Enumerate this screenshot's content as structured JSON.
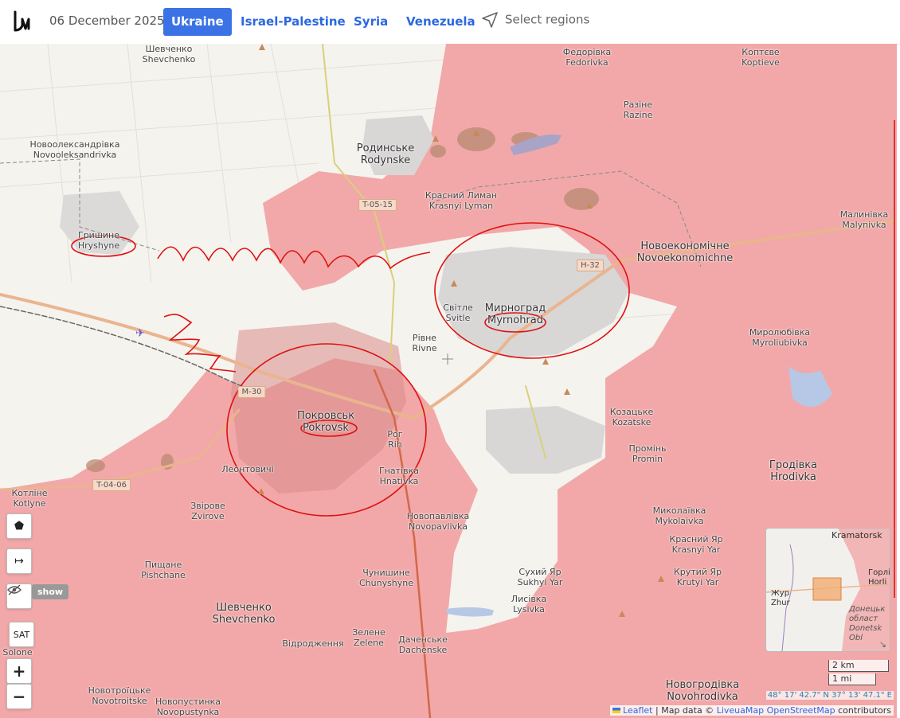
{
  "header": {
    "date": "06 December 2025",
    "tabs": [
      {
        "label": "Ukraine",
        "active": true
      },
      {
        "label": "Israel-Palestine",
        "active": false
      },
      {
        "label": "Syria",
        "active": false
      },
      {
        "label": "Venezuela",
        "active": false
      }
    ],
    "select_regions": "Select regions"
  },
  "map": {
    "labels": [
      {
        "uk": "Шевченко",
        "en": "Shevchenko"
      },
      {
        "uk": "Федорівка",
        "en": "Fedorivka"
      },
      {
        "uk": "Коптєве",
        "en": "Koptieve"
      },
      {
        "uk": "Разіне",
        "en": "Razine"
      },
      {
        "uk": "Новоолександрівка",
        "en": "Novooleksandrivka"
      },
      {
        "uk": "Родинське",
        "en": "Rodynske"
      },
      {
        "uk": "Красний Лиман",
        "en": "Krasnyi Lyman"
      },
      {
        "uk": "Гришине",
        "en": "Hryshyne"
      },
      {
        "uk": "Малинівка",
        "en": "Malynivka"
      },
      {
        "uk": "Новоекономічне",
        "en": "Novoekonomichne"
      },
      {
        "uk": "Мирноград",
        "en": "Myrnohrad"
      },
      {
        "uk": "Світле",
        "en": "Svitle"
      },
      {
        "uk": "Рівне",
        "en": "Rivne"
      },
      {
        "uk": "Миролюбівка",
        "en": "Myroliubivka"
      },
      {
        "uk": "Покровськ",
        "en": "Pokrovsk"
      },
      {
        "uk": "Рог",
        "en": "Rih"
      },
      {
        "uk": "Козацьке",
        "en": "Kozatske"
      },
      {
        "uk": "Промінь",
        "en": "Promin"
      },
      {
        "uk": "Леонтовичі",
        "en": ""
      },
      {
        "uk": "Гнатівка",
        "en": "Hnativka"
      },
      {
        "uk": "Котліне",
        "en": "Kotlyne"
      },
      {
        "uk": "Звірове",
        "en": "Zvirove"
      },
      {
        "uk": "Новопавлівка",
        "en": "Novopavlivka"
      },
      {
        "uk": "Гродівка",
        "en": "Hrodivka"
      },
      {
        "uk": "Миколаївка",
        "en": "Mykolaivka"
      },
      {
        "uk": "Красний Яр",
        "en": "Krasnyi Yar"
      },
      {
        "uk": "Пищане",
        "en": "Pishchane"
      },
      {
        "uk": "Сухий Яр",
        "en": "Sukhyi Yar"
      },
      {
        "uk": "Крутий Яр",
        "en": "Krutyi Yar"
      },
      {
        "uk": "Чунишине",
        "en": "Chunyshyne"
      },
      {
        "uk": "Лисівка",
        "en": "Lysivka"
      },
      {
        "uk": "Шевченко",
        "en": "Shevchenko"
      },
      {
        "uk": "Зелене",
        "en": "Zelene"
      },
      {
        "uk": "Відродження",
        "en": ""
      },
      {
        "uk": "Даченське",
        "en": "Dachenske"
      },
      {
        "uk": "Новогродівка",
        "en": "Novohrodivka"
      },
      {
        "uk": "Новотроїцьке",
        "en": "Novotroitske"
      },
      {
        "uk": "Новопустинка",
        "en": "Novopustynka"
      },
      {
        "uk": "",
        "en": "Solone"
      }
    ],
    "road_shields": [
      "T-05-15",
      "H-32",
      "M-30",
      "T-04-06"
    ],
    "controls": {
      "polygon": "⬟",
      "measure": "↦",
      "hide": "show",
      "sat": "SAT",
      "zoom_in": "+",
      "zoom_out": "−"
    },
    "minimap_labels": [
      "Kramatorsk",
      "Горлі",
      "Horli",
      "Жур",
      "Zhur",
      "Донецьк",
      "област",
      "Donetsk",
      "Obl"
    ],
    "scale": {
      "km": "2 km",
      "mi": "1 mi"
    },
    "coordinates": "48° 17' 42.7\" N 37° 13' 47.1\" E",
    "attribution": {
      "leaflet": "Leaflet",
      "sep1": " | Map data © ",
      "liveua": "LiveuaMap",
      "osm": "OpenStreetMap",
      "tail": " contributors"
    },
    "colors": {
      "occupied": "#f08f8f",
      "accent": "#3b73e6",
      "annotation": "#dd1111"
    }
  }
}
